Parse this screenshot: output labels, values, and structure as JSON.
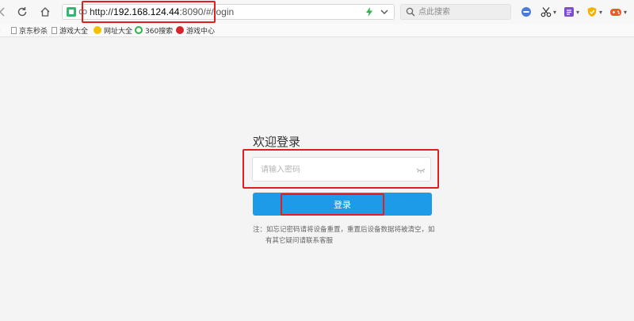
{
  "browser": {
    "url_prefix": "http://",
    "url_host": "192.168.124.44",
    "url_rest": ":8090/#/login",
    "secure_glyph": "ꝏ",
    "search_placeholder": "点此搜索"
  },
  "bookmarks": [
    {
      "label": "京东秒杀",
      "icon": "page-icon"
    },
    {
      "label": "游戏大全",
      "icon": "page-icon"
    },
    {
      "label": "网址大全",
      "icon": "globe-icon",
      "color": "#f2c200"
    },
    {
      "label": "360搜索",
      "icon": "360-icon",
      "color": "#2bb24c"
    },
    {
      "label": "游戏中心",
      "icon": "game-center-icon",
      "color": "#d7242a"
    }
  ],
  "login": {
    "title": "欢迎登录",
    "password_placeholder": "请输入密码",
    "button_label": "登录",
    "note_line1": "注：如忘记密码请将设备重置，重置后设备数据将被清空，如",
    "note_line2": "有其它疑问请联系客服"
  },
  "colors": {
    "accent": "#1d9be8",
    "highlight": "#e21f1f",
    "page_bg": "#f4f4f4"
  }
}
